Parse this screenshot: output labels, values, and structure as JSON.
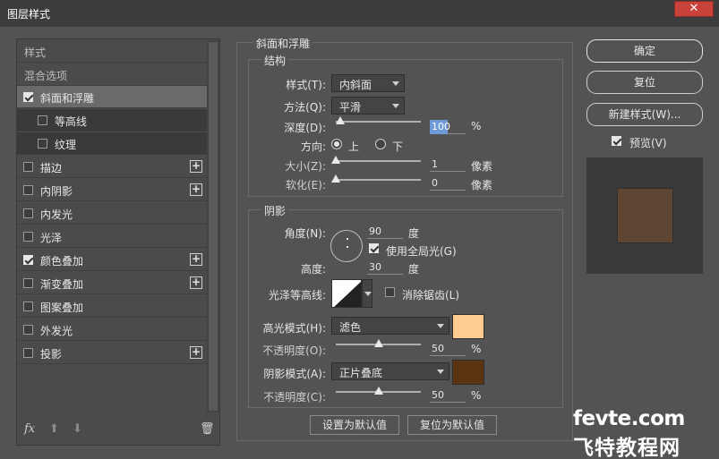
{
  "window": {
    "title": "图层样式",
    "close_label": "✕"
  },
  "left_list": {
    "items": [
      {
        "label": "样式",
        "has_checkbox": false,
        "checked": false,
        "plus": false
      },
      {
        "label": "混合选项",
        "has_checkbox": false,
        "checked": false,
        "plus": false
      },
      {
        "label": "斜面和浮雕",
        "has_checkbox": true,
        "checked": true,
        "plus": false,
        "selected": true
      },
      {
        "label": "等高线",
        "has_checkbox": true,
        "checked": false,
        "plus": false,
        "sub": true
      },
      {
        "label": "纹理",
        "has_checkbox": true,
        "checked": false,
        "plus": false,
        "sub": true
      },
      {
        "label": "描边",
        "has_checkbox": true,
        "checked": false,
        "plus": true
      },
      {
        "label": "内阴影",
        "has_checkbox": true,
        "checked": false,
        "plus": true
      },
      {
        "label": "内发光",
        "has_checkbox": true,
        "checked": false,
        "plus": false
      },
      {
        "label": "光泽",
        "has_checkbox": true,
        "checked": false,
        "plus": false
      },
      {
        "label": "颜色叠加",
        "has_checkbox": true,
        "checked": true,
        "plus": true
      },
      {
        "label": "渐变叠加",
        "has_checkbox": true,
        "checked": false,
        "plus": true
      },
      {
        "label": "图案叠加",
        "has_checkbox": true,
        "checked": false,
        "plus": false
      },
      {
        "label": "外发光",
        "has_checkbox": true,
        "checked": false,
        "plus": false
      },
      {
        "label": "投影",
        "has_checkbox": true,
        "checked": false,
        "plus": true
      }
    ],
    "footer": {
      "fx_label": "fx",
      "up_label": "⬆",
      "down_label": "⬇",
      "trash_label": "🗑"
    }
  },
  "bevel": {
    "section_title": "斜面和浮雕",
    "structure": {
      "title": "结构",
      "style_label": "样式(T):",
      "style_value": "内斜面",
      "method_label": "方法(Q):",
      "method_value": "平滑",
      "depth_label": "深度(D):",
      "depth_value": "100",
      "depth_unit": "%",
      "depth_level": 0.05,
      "direction_label": "方向:",
      "direction_up": "上",
      "direction_down": "下",
      "direction_selected": "up",
      "size_label": "大小(Z):",
      "size_value": "1",
      "size_unit": "像素",
      "size_level": 0.0,
      "soften_label": "软化(E):",
      "soften_value": "0",
      "soften_unit": "像素",
      "soften_level": 0.0
    },
    "shading": {
      "title": "阴影",
      "angle_label": "角度(N):",
      "angle_value": "90",
      "angle_unit": "度",
      "global_light_label": "使用全局光(G)",
      "global_light_checked": true,
      "altitude_label": "高度:",
      "altitude_value": "30",
      "altitude_unit": "度",
      "gloss_label": "光泽等高线:",
      "antialias_label": "消除锯齿(L)",
      "antialias_checked": false,
      "highlight_label": "高光模式(H):",
      "highlight_value": "滤色",
      "highlight_color": "#ffcc8f",
      "highlight_opacity_label": "不透明度(O):",
      "highlight_opacity_value": "50",
      "highlight_opacity_unit": "%",
      "highlight_opacity_level": 0.5,
      "shadow_label": "阴影模式(A):",
      "shadow_value": "正片叠底",
      "shadow_color": "#5a3410",
      "shadow_opacity_label": "不透明度(C):",
      "shadow_opacity_value": "50",
      "shadow_opacity_unit": "%",
      "shadow_opacity_level": 0.5
    },
    "make_default_label": "设置为默认值",
    "reset_default_label": "复位为默认值"
  },
  "right": {
    "ok_label": "确定",
    "reset_label": "复位",
    "new_style_label": "新建样式(W)...",
    "preview_label": "预览(V)",
    "preview_checked": true,
    "preview_color": "#5f4632"
  },
  "watermark": {
    "line1": "fevte.com",
    "line2": "飞特教程网"
  }
}
